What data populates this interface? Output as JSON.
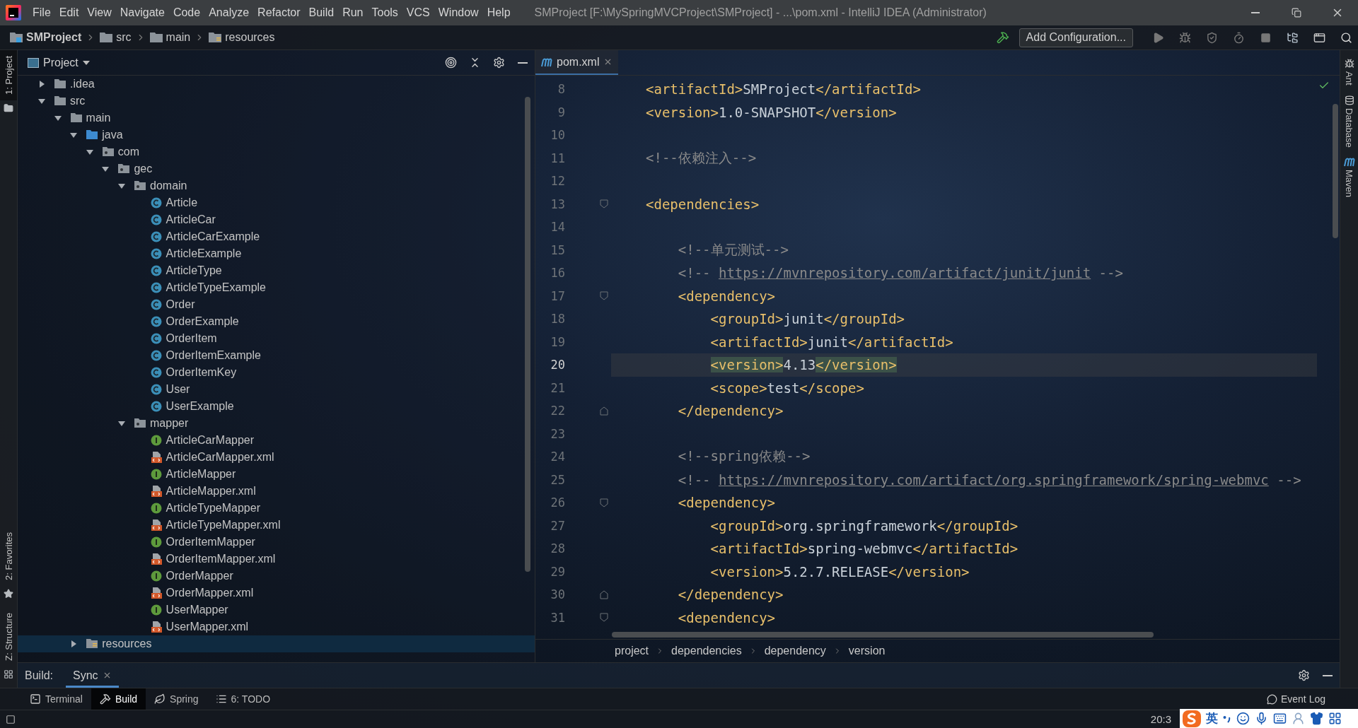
{
  "menu_bar": {
    "items": [
      "File",
      "Edit",
      "View",
      "Navigate",
      "Code",
      "Analyze",
      "Refactor",
      "Build",
      "Run",
      "Tools",
      "VCS",
      "Window",
      "Help"
    ],
    "title": "SMProject [F:\\MySpringMVCProject\\SMProject] - ...\\pom.xml - IntelliJ IDEA (Administrator)"
  },
  "nav_bar": {
    "breadcrumbs": [
      {
        "label": "SMProject",
        "kind": "module"
      },
      {
        "label": "src",
        "kind": "folder"
      },
      {
        "label": "main",
        "kind": "folder"
      },
      {
        "label": "resources",
        "kind": "resources"
      }
    ],
    "run_config": "Add Configuration..."
  },
  "left_stripe": [
    {
      "label": "1: Project",
      "kind": "project",
      "selected": true
    },
    {
      "label": "2: Favorites",
      "kind": "favorites",
      "selected": false
    },
    {
      "label": "Z: Structure",
      "kind": "structure",
      "selected": false
    }
  ],
  "right_stripe": [
    {
      "label": "Ant",
      "kind": "ant"
    },
    {
      "label": "Database",
      "kind": "database"
    },
    {
      "label": "Maven",
      "kind": "maven"
    }
  ],
  "project_panel": {
    "title": "Project",
    "tree": [
      {
        "label": ".idea",
        "kind": "folder",
        "expanded": false,
        "selected": false
      },
      {
        "label": "src",
        "kind": "folder",
        "expanded": true,
        "selected": false,
        "children": [
          {
            "label": "main",
            "kind": "folder",
            "expanded": true,
            "selected": false,
            "children": [
              {
                "label": "java",
                "kind": "source",
                "expanded": true,
                "selected": false,
                "children": [
                  {
                    "label": "com",
                    "kind": "package",
                    "expanded": true,
                    "selected": false,
                    "children": [
                      {
                        "label": "gec",
                        "kind": "package",
                        "expanded": true,
                        "selected": false,
                        "children": [
                          {
                            "label": "domain",
                            "kind": "package",
                            "expanded": true,
                            "selected": false,
                            "children": [
                              {
                                "label": "Article",
                                "kind": "class",
                                "selected": false
                              },
                              {
                                "label": "ArticleCar",
                                "kind": "class",
                                "selected": false
                              },
                              {
                                "label": "ArticleCarExample",
                                "kind": "class",
                                "selected": false
                              },
                              {
                                "label": "ArticleExample",
                                "kind": "class",
                                "selected": false
                              },
                              {
                                "label": "ArticleType",
                                "kind": "class",
                                "selected": false
                              },
                              {
                                "label": "ArticleTypeExample",
                                "kind": "class",
                                "selected": false
                              },
                              {
                                "label": "Order",
                                "kind": "class",
                                "selected": false
                              },
                              {
                                "label": "OrderExample",
                                "kind": "class",
                                "selected": false
                              },
                              {
                                "label": "OrderItem",
                                "kind": "class",
                                "selected": false
                              },
                              {
                                "label": "OrderItemExample",
                                "kind": "class",
                                "selected": false
                              },
                              {
                                "label": "OrderItemKey",
                                "kind": "class",
                                "selected": false
                              },
                              {
                                "label": "User",
                                "kind": "class",
                                "selected": false
                              },
                              {
                                "label": "UserExample",
                                "kind": "class",
                                "selected": false
                              }
                            ]
                          },
                          {
                            "label": "mapper",
                            "kind": "package",
                            "expanded": true,
                            "selected": false,
                            "children": [
                              {
                                "label": "ArticleCarMapper",
                                "kind": "interface",
                                "selected": false
                              },
                              {
                                "label": "ArticleCarMapper.xml",
                                "kind": "xml",
                                "selected": false
                              },
                              {
                                "label": "ArticleMapper",
                                "kind": "interface",
                                "selected": false
                              },
                              {
                                "label": "ArticleMapper.xml",
                                "kind": "xml",
                                "selected": false
                              },
                              {
                                "label": "ArticleTypeMapper",
                                "kind": "interface",
                                "selected": false
                              },
                              {
                                "label": "ArticleTypeMapper.xml",
                                "kind": "xml",
                                "selected": false
                              },
                              {
                                "label": "OrderItemMapper",
                                "kind": "interface",
                                "selected": false
                              },
                              {
                                "label": "OrderItemMapper.xml",
                                "kind": "xml",
                                "selected": false
                              },
                              {
                                "label": "OrderMapper",
                                "kind": "interface",
                                "selected": false
                              },
                              {
                                "label": "OrderMapper.xml",
                                "kind": "xml",
                                "selected": false
                              },
                              {
                                "label": "UserMapper",
                                "kind": "interface",
                                "selected": false
                              },
                              {
                                "label": "UserMapper.xml",
                                "kind": "xml",
                                "selected": false
                              }
                            ]
                          }
                        ]
                      }
                    ]
                  }
                ]
              },
              {
                "label": "resources",
                "kind": "resources",
                "expanded": false,
                "selected": true
              }
            ]
          }
        ]
      }
    ]
  },
  "editor": {
    "tab": {
      "label": "pom.xml",
      "selected": true
    },
    "lines": [
      {
        "number": "8",
        "current": false,
        "segments": [
          {
            "kind": "tag",
            "text": "<artifactId>"
          },
          {
            "kind": "text",
            "text": "SMProject"
          },
          {
            "kind": "tag",
            "text": "</artifactId>"
          }
        ]
      },
      {
        "number": "9",
        "current": false,
        "segments": [
          {
            "kind": "tag",
            "text": "<version>"
          },
          {
            "kind": "text",
            "text": "1.0-SNAPSHOT"
          },
          {
            "kind": "tag",
            "text": "</version>"
          }
        ]
      },
      {
        "number": "10",
        "current": false
      },
      {
        "number": "11",
        "current": false,
        "segments": [
          {
            "kind": "comment",
            "text": "<!--依赖注入-->"
          }
        ]
      },
      {
        "number": "12",
        "current": false
      },
      {
        "number": "13",
        "current": false,
        "fold_start": true,
        "segments": [
          {
            "kind": "tag",
            "text": "<dependencies>"
          }
        ],
        "children": [
          {
            "number": "14",
            "current": false
          },
          {
            "number": "15",
            "current": false,
            "segments": [
              {
                "kind": "comment",
                "text": "<!--单元测试-->"
              }
            ]
          },
          {
            "number": "16",
            "current": false,
            "segments": [
              {
                "kind": "comment",
                "text": "<!-- "
              },
              {
                "kind": "link",
                "text": "https://mvnrepository.com/artifact/junit/junit"
              },
              {
                "kind": "comment",
                "text": " -->"
              }
            ]
          },
          {
            "number": "17",
            "current": false,
            "fold_start": true,
            "segments": [
              {
                "kind": "tag",
                "text": "<dependency>"
              }
            ],
            "children": [
              {
                "number": "18",
                "current": false,
                "segments": [
                  {
                    "kind": "tag",
                    "text": "<groupId>"
                  },
                  {
                    "kind": "text",
                    "text": "junit"
                  },
                  {
                    "kind": "tag",
                    "text": "</groupId>"
                  }
                ]
              },
              {
                "number": "19",
                "current": false,
                "segments": [
                  {
                    "kind": "tag",
                    "text": "<artifactId>"
                  },
                  {
                    "kind": "text",
                    "text": "junit"
                  },
                  {
                    "kind": "tag",
                    "text": "</artifactId>"
                  }
                ]
              },
              {
                "number": "20",
                "current": true,
                "segments": [
                  {
                    "kind": "tag",
                    "text": "<version>",
                    "matched": true
                  },
                  {
                    "kind": "text",
                    "text": "4.13",
                    "matched": false
                  },
                  {
                    "kind": "tag",
                    "text": "</version>",
                    "matched": true
                  }
                ]
              },
              {
                "number": "21",
                "current": false,
                "segments": [
                  {
                    "kind": "tag",
                    "text": "<scope>"
                  },
                  {
                    "kind": "text",
                    "text": "test"
                  },
                  {
                    "kind": "tag",
                    "text": "</scope>"
                  }
                ]
              }
            ]
          },
          {
            "number": "22",
            "current": false,
            "fold_end": true,
            "segments": [
              {
                "kind": "tag",
                "text": "</dependency>"
              }
            ]
          },
          {
            "number": "23",
            "current": false
          },
          {
            "number": "24",
            "current": false,
            "segments": [
              {
                "kind": "comment",
                "text": "<!--spring依赖-->"
              }
            ]
          },
          {
            "number": "25",
            "current": false,
            "segments": [
              {
                "kind": "comment",
                "text": "<!-- "
              },
              {
                "kind": "link",
                "text": "https://mvnrepository.com/artifact/org.springframework/spring-webmvc"
              },
              {
                "kind": "comment",
                "text": " -->"
              }
            ]
          },
          {
            "number": "26",
            "current": false,
            "fold_start": true,
            "segments": [
              {
                "kind": "tag",
                "text": "<dependency>"
              }
            ],
            "children": [
              {
                "number": "27",
                "current": false,
                "segments": [
                  {
                    "kind": "tag",
                    "text": "<groupId>"
                  },
                  {
                    "kind": "text",
                    "text": "org.springframework"
                  },
                  {
                    "kind": "tag",
                    "text": "</groupId>"
                  }
                ]
              },
              {
                "number": "28",
                "current": false,
                "segments": [
                  {
                    "kind": "tag",
                    "text": "<artifactId>"
                  },
                  {
                    "kind": "text",
                    "text": "spring-webmvc"
                  },
                  {
                    "kind": "tag",
                    "text": "</artifactId>"
                  }
                ]
              },
              {
                "number": "29",
                "current": false,
                "segments": [
                  {
                    "kind": "tag",
                    "text": "<version>"
                  },
                  {
                    "kind": "text",
                    "text": "5.2.7.RELEASE"
                  },
                  {
                    "kind": "tag",
                    "text": "</version>"
                  }
                ]
              }
            ]
          },
          {
            "number": "30",
            "current": false,
            "fold_end": true,
            "segments": [
              {
                "kind": "tag",
                "text": "</dependency>"
              }
            ]
          },
          {
            "number": "31",
            "current": false,
            "fold_start": true,
            "segments": [
              {
                "kind": "tag",
                "text": "<dependency>"
              }
            ]
          }
        ]
      }
    ],
    "breadcrumbs": [
      "project",
      "dependencies",
      "dependency",
      "version"
    ]
  },
  "build_panel": {
    "label": "Build:",
    "tabs": [
      {
        "label": "Sync",
        "selected": true
      }
    ]
  },
  "tool_bar": [
    {
      "label": "Terminal",
      "kind": "terminal",
      "selected": false
    },
    {
      "label": "Build",
      "kind": "build",
      "selected": true
    },
    {
      "label": "Spring",
      "kind": "spring",
      "selected": false
    },
    {
      "label": "6: TODO",
      "kind": "todo",
      "selected": false
    }
  ],
  "event_log": "Event Log",
  "status_bar": {
    "time": "20:3"
  },
  "ime_bar": {
    "mode": "英"
  }
}
